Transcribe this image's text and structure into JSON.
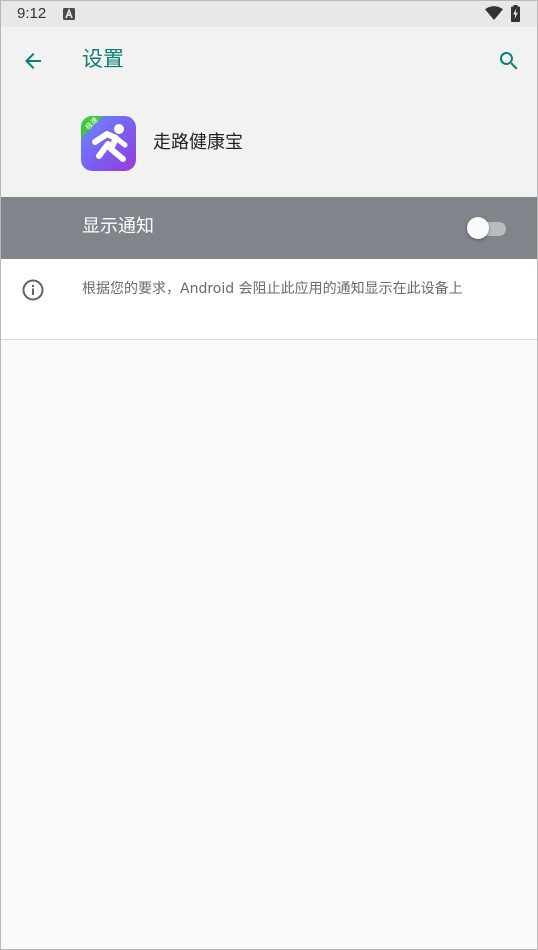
{
  "status_bar": {
    "time": "9:12",
    "notification_icon": "a-letter-icon",
    "wifi_icon": "wifi-icon",
    "battery_icon": "battery-charging-icon"
  },
  "header": {
    "back_icon": "arrow-back-icon",
    "title": "设置",
    "search_icon": "search-icon",
    "accent_color": "#0b7f73"
  },
  "app": {
    "name": "走路健康宝",
    "icon": "running-man-app-icon",
    "badge_text": "极速"
  },
  "notification_toggle": {
    "label": "显示通知",
    "enabled": false,
    "row_color": "#80858b"
  },
  "info": {
    "icon": "info-icon",
    "text": "根据您的要求，Android 会阻止此应用的通知显示在此设备上"
  }
}
